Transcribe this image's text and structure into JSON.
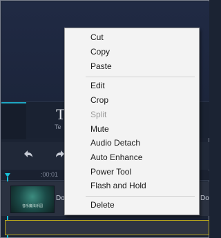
{
  "preview_tab": {
    "big_text": "T",
    "small_text": "Te"
  },
  "timeline": {
    "ruler_label": ":00:01",
    "clip": {
      "thumbnail_caption": "音乐魔法乐园",
      "title_left": "Do",
      "title_right": "Do"
    }
  },
  "icons": {
    "undo": "undo-icon",
    "redo": "redo-icon",
    "playhead": "playhead-icon"
  },
  "colors": {
    "accent": "#16c1d9",
    "menu_bg": "#f3f3f3",
    "track_border": "#b7a51c"
  },
  "context_menu": {
    "items": [
      {
        "label": "Cut",
        "enabled": true
      },
      {
        "label": "Copy",
        "enabled": true
      },
      {
        "label": "Paste",
        "enabled": true
      },
      {
        "label": "Edit",
        "enabled": true
      },
      {
        "label": "Crop",
        "enabled": true
      },
      {
        "label": "Split",
        "enabled": false
      },
      {
        "label": "Mute",
        "enabled": true
      },
      {
        "label": "Audio Detach",
        "enabled": true
      },
      {
        "label": "Auto Enhance",
        "enabled": true
      },
      {
        "label": "Power Tool",
        "enabled": true
      },
      {
        "label": "Flash and Hold",
        "enabled": true
      },
      {
        "label": "Delete",
        "enabled": true
      }
    ]
  }
}
